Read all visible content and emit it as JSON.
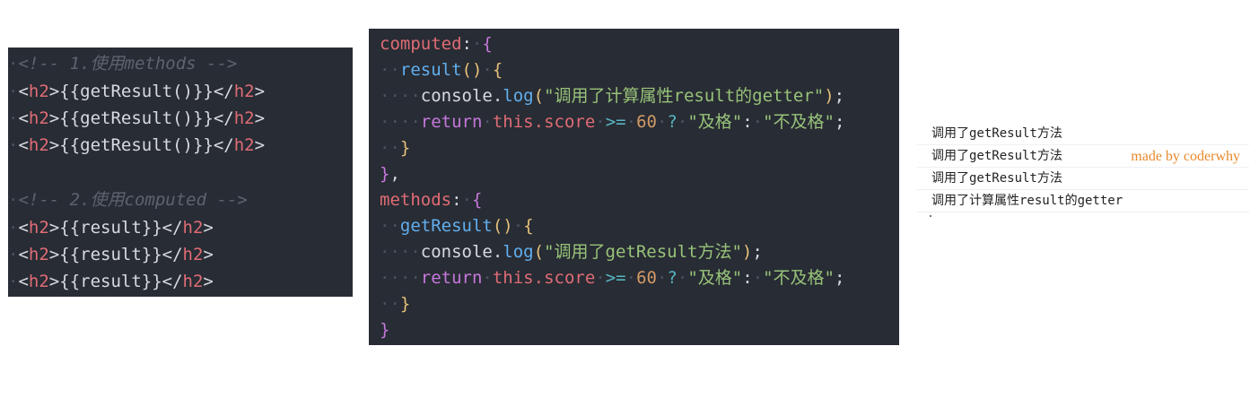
{
  "template_panel": {
    "lines": [
      {
        "c1": "<!-- 1.使用methods -->"
      },
      {
        "open": "<",
        "t1": "h2",
        "m1": ">",
        "expr": "{{getResult()}}",
        "close_open": "</",
        "t2": "h2",
        "end": ">"
      },
      {
        "open": "<",
        "t1": "h2",
        "m1": ">",
        "expr": "{{getResult()}}",
        "close_open": "</",
        "t2": "h2",
        "end": ">"
      },
      {
        "open": "<",
        "t1": "h2",
        "m1": ">",
        "expr": "{{getResult()}}",
        "close_open": "</",
        "t2": "h2",
        "end": ">"
      },
      {
        "c1": "<!-- 2.使用computed -->"
      },
      {
        "open": "<",
        "t1": "h2",
        "m1": ">",
        "expr": "{{result}}",
        "close_open": "</",
        "t2": "h2",
        "end": ">"
      },
      {
        "open": "<",
        "t1": "h2",
        "m1": ">",
        "expr": "{{result}}",
        "close_open": "</",
        "t2": "h2",
        "end": ">"
      },
      {
        "open": "<",
        "t1": "h2",
        "m1": ">",
        "expr": "{{result}}",
        "close_open": "</",
        "t2": "h2",
        "end": ">"
      }
    ]
  },
  "script_panel": {
    "computed_key": "computed",
    "result_fn": "result",
    "console_obj": "console.",
    "log": "log",
    "result_log_str": "\"调用了计算属性result的getter\"",
    "return_kw": "return",
    "this_kw": "this",
    "score_prop": ".score",
    "gte": ">=",
    "sixty": "60",
    "q": "?",
    "pass_str": "\"及格\"",
    "fail_str": "\"不及格\"",
    "methods_key": "methods",
    "getresult_fn": "getResult",
    "getresult_log_str": "\"调用了getResult方法\""
  },
  "console_output": {
    "rows": [
      "调用了getResult方法",
      "调用了getResult方法",
      "调用了getResult方法",
      "调用了计算属性result的getter"
    ],
    "watermark": "made by coderwhy"
  }
}
